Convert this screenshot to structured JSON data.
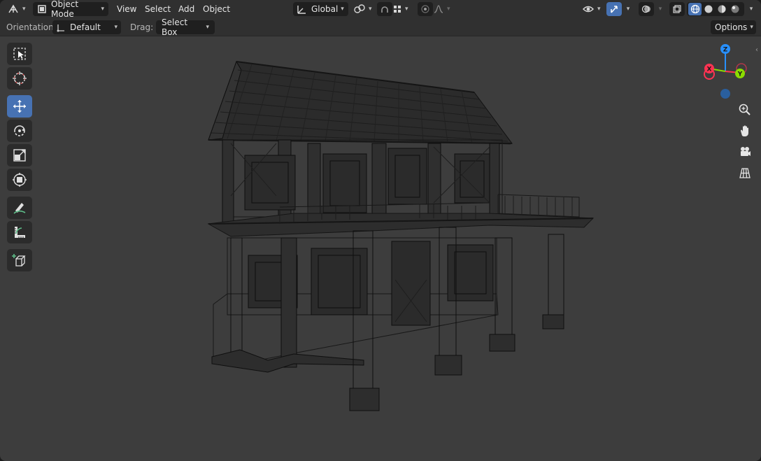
{
  "header": {
    "editor_type_icon": "viewport-editor-icon",
    "mode": {
      "label": "Object Mode",
      "icon": "object-mode-icon"
    },
    "menus": [
      "View",
      "Select",
      "Add",
      "Object"
    ],
    "transform_orientation": {
      "label": "Global",
      "icon": "transform-orientation-icon"
    },
    "pivot_icon": "pivot-point-icon",
    "snap_icon": "snap-magnet-icon",
    "snap_target_icon": "snap-target-icon",
    "proportional_icon": "proportional-editing-icon",
    "falloff_icon": "falloff-curve-icon",
    "visibility_icon": "eye-visibility-icon",
    "gizmo_icon": "gizmo-toggle-icon",
    "overlay_icon": "overlay-icon",
    "xray_icon": "xray-toggle-icon",
    "shading_modes": [
      "wireframe",
      "solid",
      "material-preview",
      "rendered"
    ],
    "active_shading": "wireframe"
  },
  "toolsettings": {
    "orientation_label": "Orientation:",
    "orientation_value": "Default",
    "drag_label": "Drag:",
    "drag_value": "Select Box",
    "options_label": "Options"
  },
  "toolbar": {
    "tools": [
      "select-box",
      "cursor",
      "move",
      "rotate",
      "scale",
      "transform",
      "annotate",
      "measure",
      "add-cube"
    ],
    "active_tool": "move"
  },
  "navigation_gizmo": {
    "axes": {
      "z": "Z",
      "y": "Y",
      "x": "X"
    },
    "colors": {
      "x": "#ff3352",
      "y": "#8bdc00",
      "z": "#2890ff"
    }
  },
  "nav_buttons": [
    "zoom-icon",
    "pan-hand-icon",
    "camera-view-icon",
    "orthographic-grid-icon"
  ],
  "viewport": {
    "background": "#3d3d3d",
    "wire_color": "#000000",
    "shading": "wireframe"
  },
  "colors": {
    "header_bg": "#303030",
    "active_blue": "#4772b3",
    "button_dark": "#1f1f1f"
  }
}
